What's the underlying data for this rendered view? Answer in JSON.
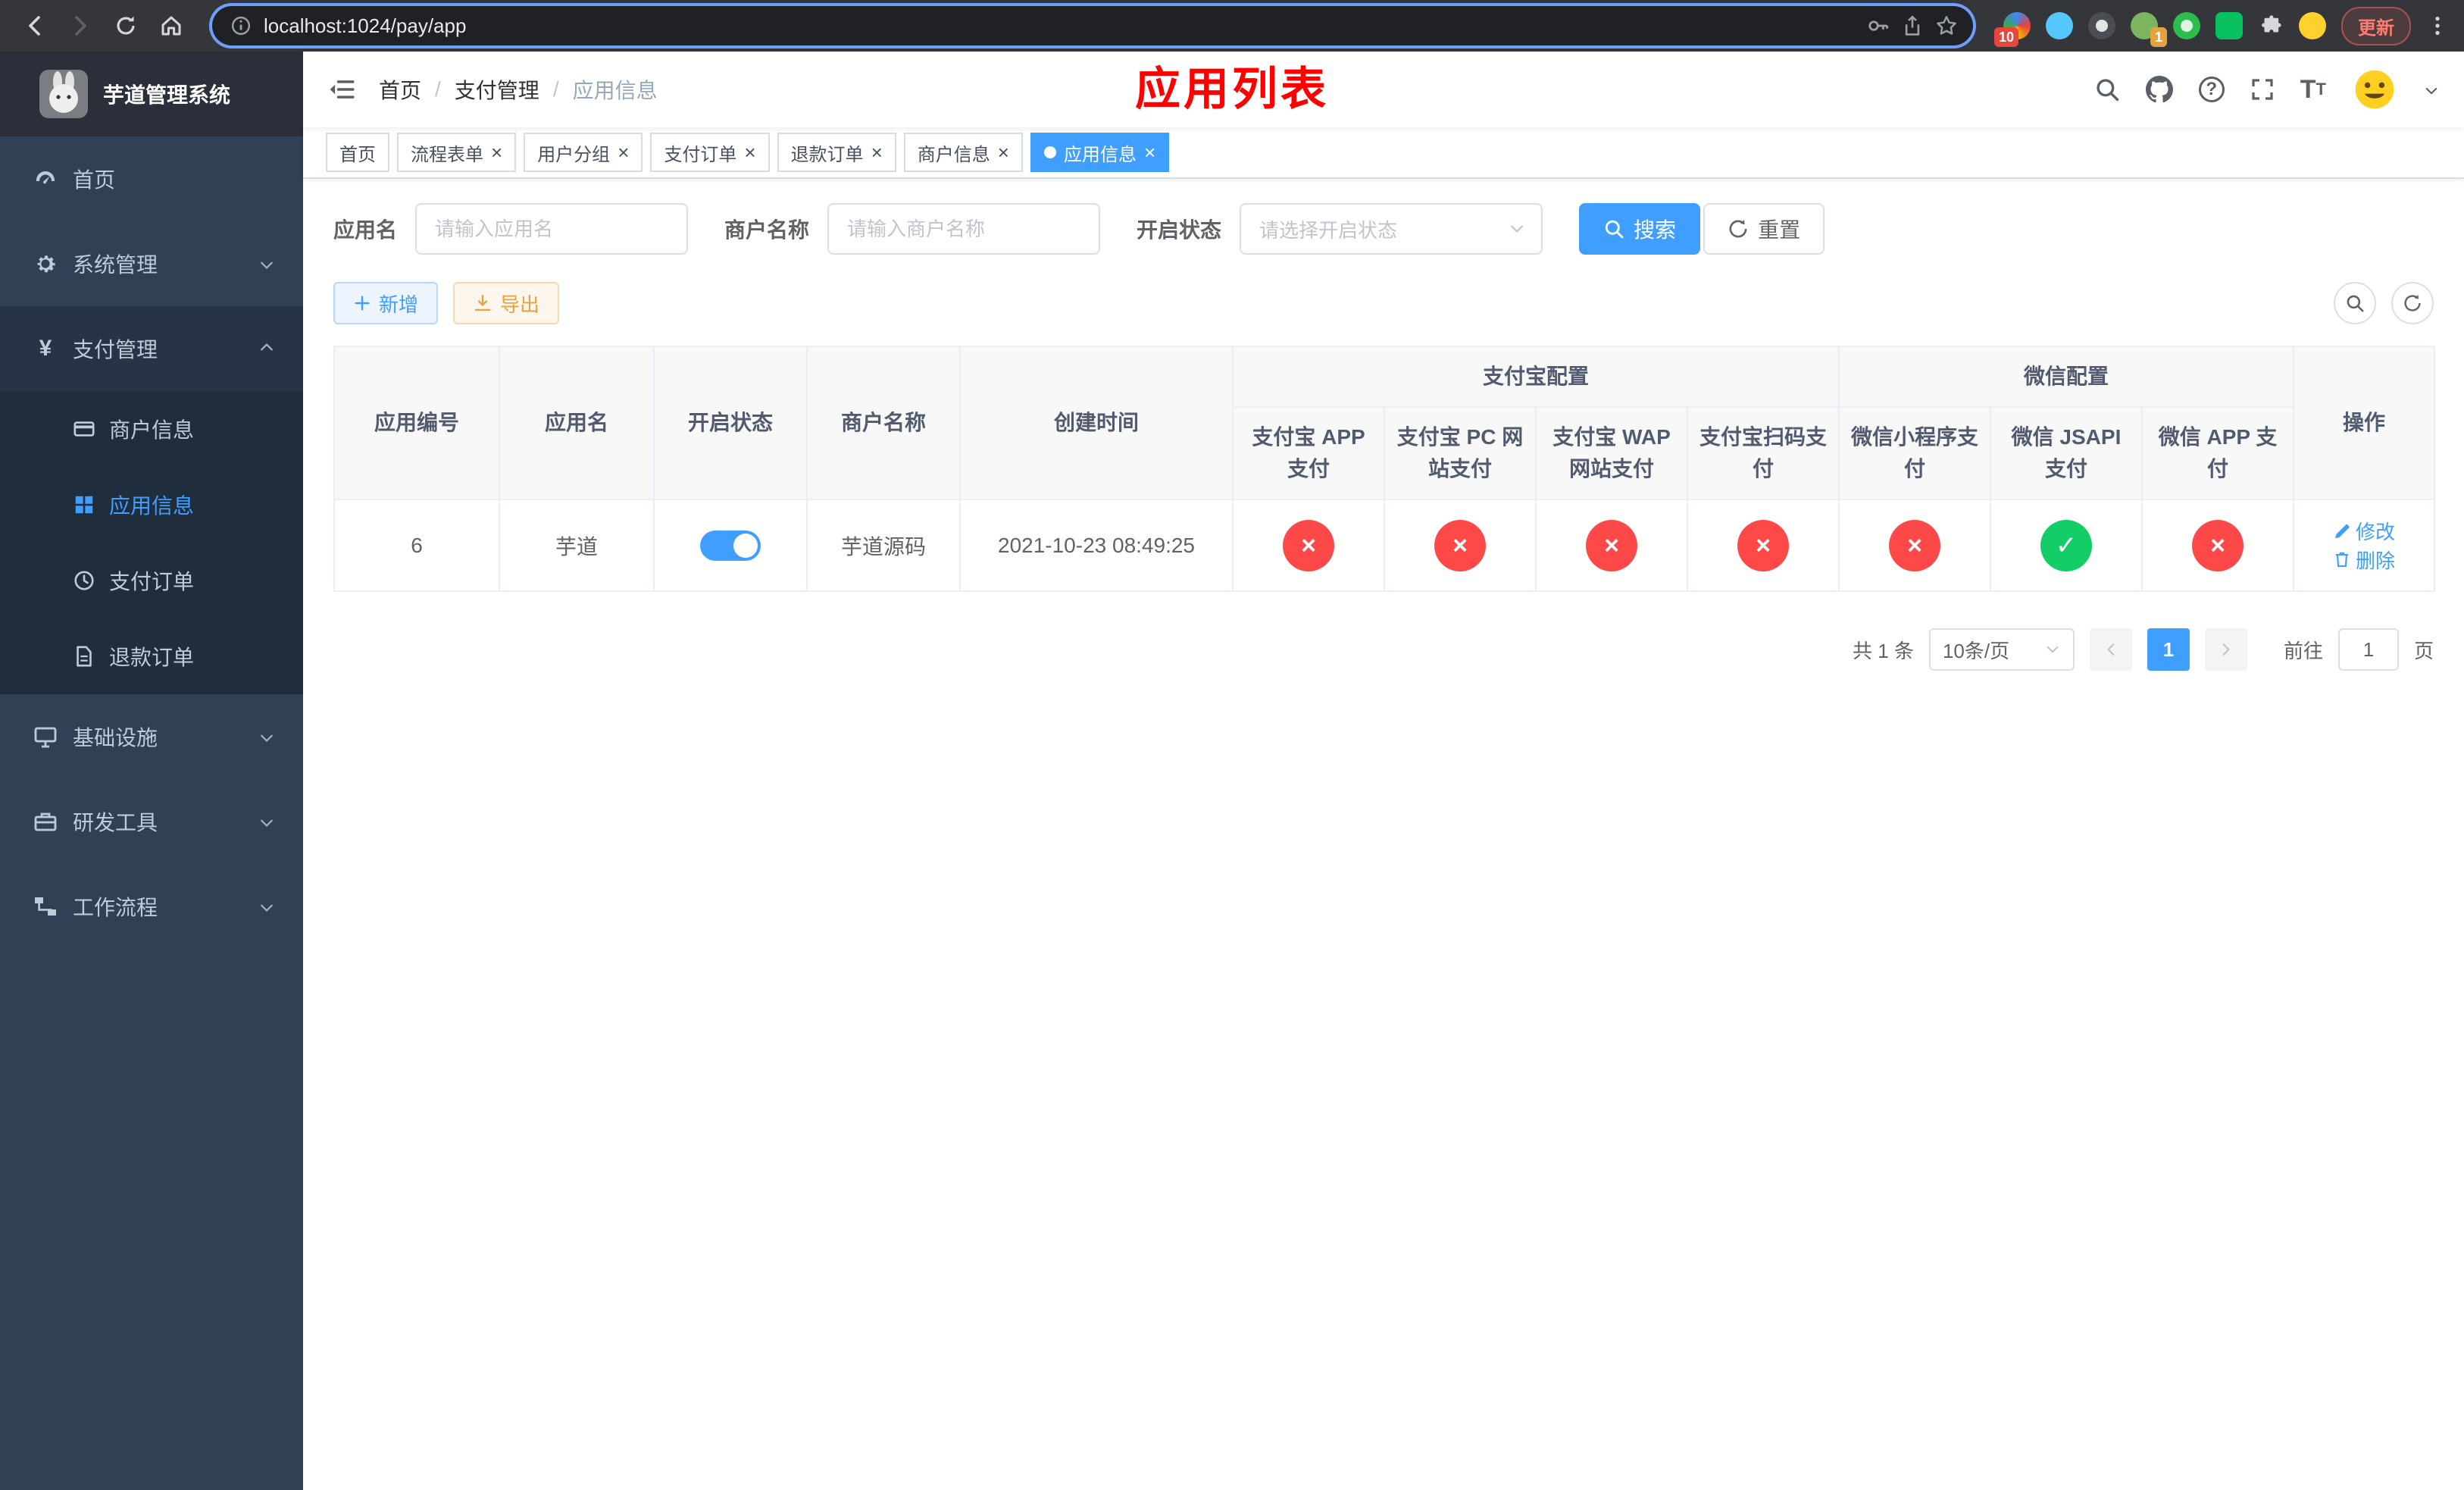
{
  "colors": {
    "accent": "#409eff",
    "success": "#13ce66",
    "danger": "#ff4949",
    "warning": "#e6a23c",
    "overlay_title_red": "#ff0000",
    "sidebar_bg": "#304156",
    "sidebar_submenu_bg": "#1f2d3d"
  },
  "browser": {
    "url": "localhost:1024/pay/app",
    "update_label": "更新",
    "badges": {
      "extensions": "10",
      "avatar": "1"
    }
  },
  "sidebar": {
    "title": "芋道管理系统",
    "items": [
      {
        "label": "首页"
      },
      {
        "label": "系统管理"
      },
      {
        "label": "支付管理",
        "children": [
          {
            "label": "商户信息"
          },
          {
            "label": "应用信息"
          },
          {
            "label": "支付订单"
          },
          {
            "label": "退款订单"
          }
        ]
      },
      {
        "label": "基础设施"
      },
      {
        "label": "研发工具"
      },
      {
        "label": "工作流程"
      }
    ]
  },
  "header": {
    "breadcrumb": [
      "首页",
      "支付管理",
      "应用信息"
    ],
    "overlay_title": "应用列表"
  },
  "tabs": [
    {
      "label": "首页",
      "closable": false
    },
    {
      "label": "流程表单",
      "closable": true
    },
    {
      "label": "用户分组",
      "closable": true
    },
    {
      "label": "支付订单",
      "closable": true
    },
    {
      "label": "退款订单",
      "closable": true
    },
    {
      "label": "商户信息",
      "closable": true
    },
    {
      "label": "应用信息",
      "closable": true,
      "active": true
    }
  ],
  "filters": {
    "app_name_label": "应用名",
    "app_name_placeholder": "请输入应用名",
    "merchant_name_label": "商户名称",
    "merchant_name_placeholder": "请输入商户名称",
    "status_label": "开启状态",
    "status_placeholder": "请选择开启状态",
    "search_label": "搜索",
    "reset_label": "重置"
  },
  "toolbar": {
    "add_label": "新增",
    "export_label": "导出"
  },
  "table": {
    "plain_columns": [
      "应用编号",
      "应用名",
      "开启状态",
      "商户名称",
      "创建时间"
    ],
    "alipay_group": "支付宝配置",
    "wechat_group": "微信配置",
    "alipay_columns": [
      "支付宝 APP 支付",
      "支付宝 PC 网站支付",
      "支付宝 WAP 网站支付",
      "支付宝扫码支付"
    ],
    "wechat_columns": [
      "微信小程序支付",
      "微信 JSAPI 支付",
      "微信 APP 支付"
    ],
    "ops_column": "操作",
    "row": {
      "id": "6",
      "name": "芋道",
      "enabled": true,
      "merchant": "芋道源码",
      "created": "2021-10-23 08:49:25",
      "pay_flags": [
        false,
        false,
        false,
        false,
        false,
        true,
        false
      ],
      "edit_label": "修改",
      "delete_label": "删除"
    }
  },
  "pagination": {
    "total": "共 1 条",
    "page_size": "10条/页",
    "current_page": "1",
    "goto_label": "前往",
    "goto_value": "1",
    "page_unit": "页"
  }
}
